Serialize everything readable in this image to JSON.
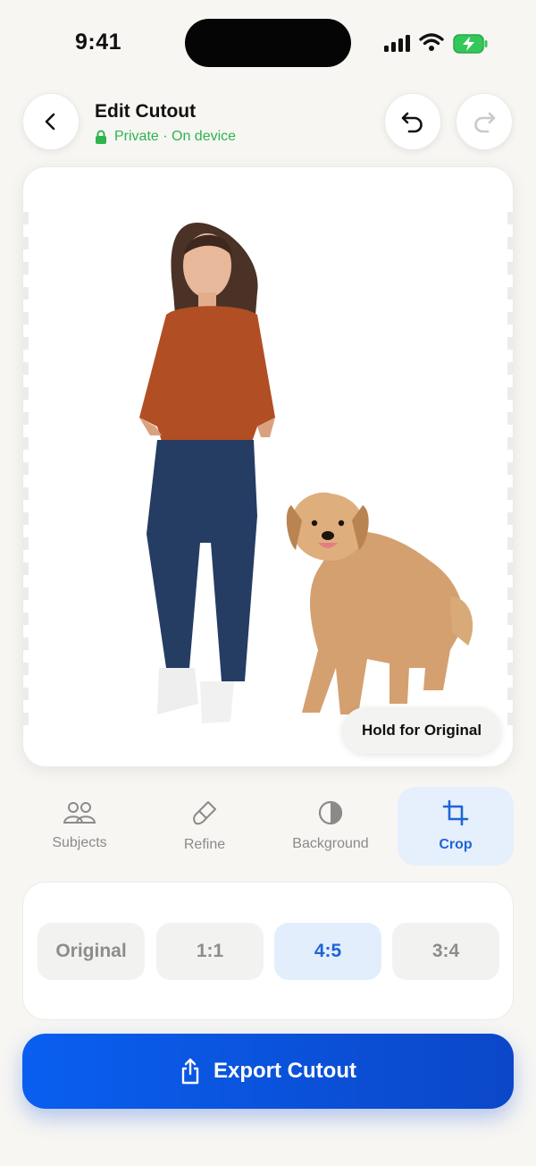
{
  "status": {
    "time": "9:41"
  },
  "header": {
    "title": "Edit Cutout",
    "subtitle": "Private · On device"
  },
  "canvas": {
    "hold_label": "Hold for Original"
  },
  "tools": [
    {
      "label": "Subjects",
      "icon": "people-icon"
    },
    {
      "label": "Refine",
      "icon": "brush-icon"
    },
    {
      "label": "Background",
      "icon": "contrast-icon"
    },
    {
      "label": "Crop",
      "icon": "crop-icon",
      "active": true
    }
  ],
  "ratios": [
    {
      "label": "Original"
    },
    {
      "label": "1:1"
    },
    {
      "label": "4:5",
      "active": true
    },
    {
      "label": "3:4"
    }
  ],
  "export": {
    "label": "Export Cutout"
  },
  "colors": {
    "accent": "#1e64d8",
    "private_green": "#2fb34f",
    "battery_green": "#34c759"
  }
}
